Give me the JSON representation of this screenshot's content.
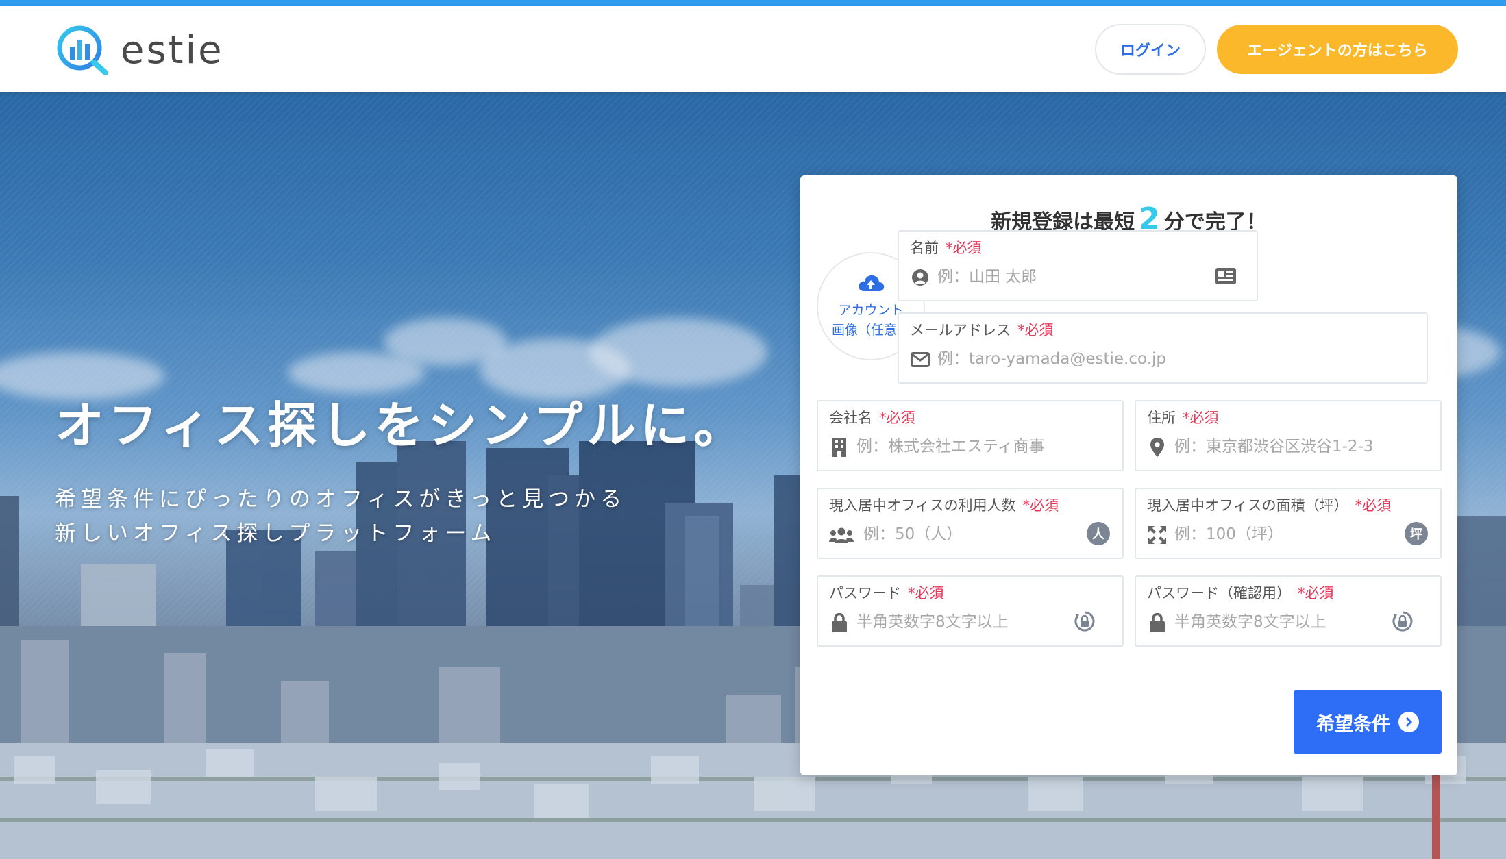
{
  "header": {
    "logo_text": "estie",
    "login_label": "ログイン",
    "agent_label": "エージェントの方はこちら"
  },
  "hero": {
    "title": "オフィス探しをシンプルに。",
    "subtitle_line1": "希望条件にぴったりのオフィスがきっと見つかる",
    "subtitle_line2": "新しいオフィス探しプラットフォーム"
  },
  "form": {
    "title_prefix": "新規登録は最短",
    "title_number": "2",
    "title_suffix": "分で完了！",
    "avatar_line1": "アカウント",
    "avatar_line2": "画像（任意）",
    "required_mark": "*必須",
    "fields": {
      "name": {
        "label": "名前",
        "placeholder": "例：山田 太郎"
      },
      "email": {
        "label": "メールアドレス",
        "placeholder": "例：taro-yamada@estie.co.jp"
      },
      "company": {
        "label": "会社名",
        "placeholder": "例：株式会社エスティ商事"
      },
      "address": {
        "label": "住所",
        "placeholder": "例：東京都渋谷区渋谷1-2-3"
      },
      "people": {
        "label": "現入居中オフィスの利用人数",
        "placeholder": "例：50（人）",
        "badge": "人"
      },
      "area": {
        "label": "現入居中オフィスの面積（坪）",
        "placeholder": "例：100（坪）",
        "badge": "坪"
      },
      "password": {
        "label": "パスワード",
        "placeholder": "半角英数字8文字以上"
      },
      "password_confirm": {
        "label": "パスワード（確認用）",
        "placeholder": "半角英数字8文字以上"
      }
    },
    "submit_label": "希望条件"
  },
  "colors": {
    "brand_blue": "#2f9cf0",
    "agent_yellow": "#fbb82b",
    "primary_button": "#2e6ef7",
    "required_red": "#e8385a",
    "accent_cyan": "#36c9ea"
  },
  "icons": [
    "logo-icon",
    "cloud-upload-icon",
    "user-circle-icon",
    "id-card-icon",
    "envelope-icon",
    "building-icon",
    "map-pin-icon",
    "users-icon",
    "expand-icon",
    "lock-icon",
    "password-generate-icon",
    "chevron-right-circle-icon"
  ]
}
